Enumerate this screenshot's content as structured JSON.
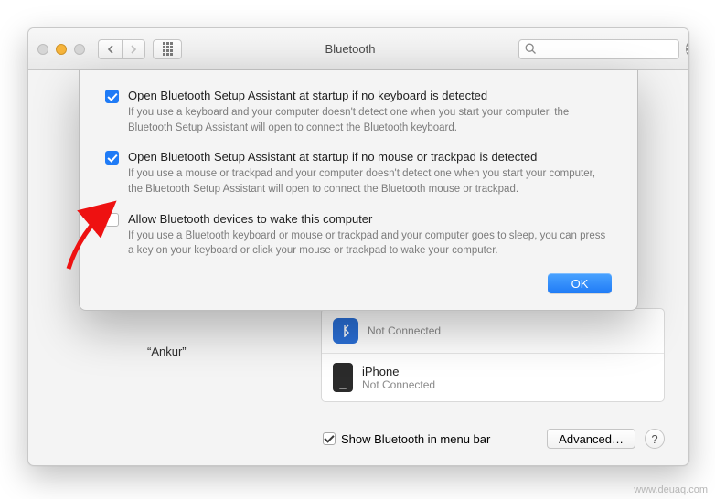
{
  "window": {
    "title": "Bluetooth",
    "search_placeholder": ""
  },
  "sheet": {
    "options": [
      {
        "checked": true,
        "title": "Open Bluetooth Setup Assistant at startup if no keyboard is detected",
        "desc": "If you use a keyboard and your computer doesn't detect one when you start your computer, the Bluetooth Setup Assistant will open to connect the Bluetooth keyboard."
      },
      {
        "checked": true,
        "title": "Open Bluetooth Setup Assistant at startup if no mouse or trackpad is detected",
        "desc": "If you use a mouse or trackpad and your computer doesn't detect one when you start your computer, the Bluetooth Setup Assistant will open to connect the Bluetooth mouse or trackpad."
      },
      {
        "checked": false,
        "title": "Allow Bluetooth devices to wake this computer",
        "desc": "If you use a Bluetooth keyboard or mouse or trackpad and your computer goes to sleep, you can press a key on your keyboard or click your mouse or trackpad to wake your computer."
      }
    ],
    "ok_label": "OK"
  },
  "back": {
    "computer_name": "“Ankur”",
    "devices": [
      {
        "name": "",
        "status": "Not Connected",
        "icon": "generic"
      },
      {
        "name": "iPhone",
        "status": "Not Connected",
        "icon": "phone"
      }
    ],
    "menubar_label": "Show Bluetooth in menu bar",
    "menubar_checked": true,
    "advanced_label": "Advanced…",
    "help_label": "?"
  },
  "watermark": "www.deuaq.com"
}
